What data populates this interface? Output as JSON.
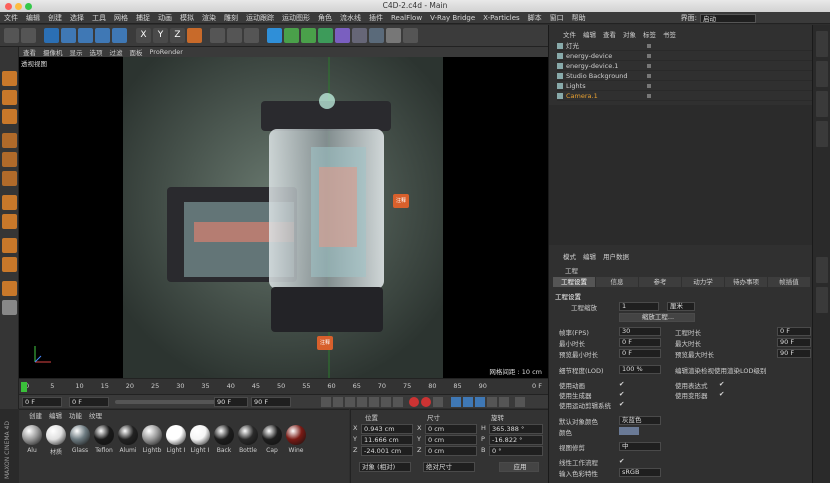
{
  "window": {
    "title": "C4D-2.c4d - Main"
  },
  "menu": [
    "文件",
    "编辑",
    "创建",
    "选择",
    "工具",
    "网格",
    "捕捉",
    "动画",
    "模拟",
    "渲染",
    "雕刻",
    "运动跟踪",
    "运动图形",
    "角色",
    "流水线",
    "插件",
    "RealFlow",
    "V-Ray Bridge",
    "X-Particles",
    "脚本",
    "窗口",
    "帮助"
  ],
  "layout": {
    "label": "界面:",
    "value": "启动"
  },
  "viewport": {
    "menu": [
      "查看",
      "摄像机",
      "显示",
      "选项",
      "过滤",
      "面板",
      "ProRender"
    ],
    "label": "透视视图",
    "grid_info": "网格间距 : 10 cm",
    "pins": [
      "注释",
      "注释"
    ]
  },
  "timeline": {
    "ticks": [
      "0",
      "5",
      "10",
      "15",
      "20",
      "25",
      "30",
      "35",
      "40",
      "45",
      "50",
      "55",
      "60",
      "65",
      "70",
      "75",
      "80",
      "85",
      "90"
    ],
    "frame_end": "0 F"
  },
  "playback": {
    "start": "0 F",
    "start2": "0 F",
    "end": "90 F",
    "end2": "90 F"
  },
  "materials": {
    "menu": [
      "创建",
      "编辑",
      "功能",
      "纹理"
    ],
    "items": [
      {
        "name": "Alu",
        "color": "#9a9a9a"
      },
      {
        "name": "材质",
        "color": "#e0e0e0"
      },
      {
        "name": "Glass",
        "color": "#6c7a80"
      },
      {
        "name": "Teflon",
        "color": "#1a1a1a"
      },
      {
        "name": "Alumi",
        "color": "#222222"
      },
      {
        "name": "Lightb",
        "color": "#9a9a9a"
      },
      {
        "name": "Light I",
        "color": "#ffffff"
      },
      {
        "name": "Light I",
        "color": "#f5f5f5"
      },
      {
        "name": "Back",
        "color": "#1d1d1d"
      },
      {
        "name": "Bottle",
        "color": "#2a2a2a"
      },
      {
        "name": "Cap",
        "color": "#1e1e1e"
      },
      {
        "name": "Wine",
        "color": "#7a1a14"
      }
    ]
  },
  "maxon": {
    "text": "MAXON CINEMA 4D"
  },
  "coords": {
    "headers": [
      "位置",
      "尺寸",
      "旋转"
    ],
    "rows": [
      {
        "axis": "X",
        "pos": "0.943 cm",
        "size": "0 cm",
        "rlabel": "H",
        "rot": "365.388 °"
      },
      {
        "axis": "Y",
        "pos": "11.666 cm",
        "size": "0 cm",
        "rlabel": "P",
        "rot": "-16.822 °"
      },
      {
        "axis": "Z",
        "pos": "-24.001 cm",
        "size": "0 cm",
        "rlabel": "B",
        "rot": "0 °"
      }
    ],
    "mode": "对象 (相对)",
    "size_mode": "绝对尺寸",
    "apply": "应用"
  },
  "objects": {
    "menu": [
      "文件",
      "编辑",
      "查看",
      "对象",
      "标签",
      "书签"
    ],
    "items": [
      {
        "name": "灯光",
        "color": "#cfcfcf"
      },
      {
        "name": "energy-device",
        "color": "#cfcfcf"
      },
      {
        "name": "energy-device.1",
        "color": "#cfcfcf"
      },
      {
        "name": "Studio Background",
        "color": "#cfcfcf"
      },
      {
        "name": "Lights",
        "color": "#cfcfcf"
      },
      {
        "name": "Camera.1",
        "color": "#e8a030"
      }
    ]
  },
  "attributes": {
    "menu": [
      "模式",
      "编辑",
      "用户数据"
    ],
    "section": "工程",
    "tabs": [
      "工程设置",
      "信息",
      "参考",
      "动力学",
      "待办事项",
      "帧插值"
    ],
    "group": "工程设置",
    "scale_label": "工程缩放",
    "scale_value": "1",
    "scale_unit": "厘米",
    "scale_button": "缩放工程...",
    "fps_label": "帧率(FPS)",
    "fps": "30",
    "duration_label": "工程时长",
    "duration": "0 F",
    "min_label": "最小时长",
    "min": "0 F",
    "max_label": "最大时长",
    "max": "90 F",
    "pmin_label": "预览最小时长",
    "pmin": "0 F",
    "pmax_label": "预览最大时长",
    "pmax": "90 F",
    "lod_label": "细节程度(LOD)",
    "lod": "100 %",
    "lod_note": "编辑渲染检视使用渲染LOD级别",
    "anim_label": "使用动画",
    "expr_label": "使用表达式",
    "gen_label": "使用生成器",
    "deform_label": "使用变形器",
    "motion_label": "使用运动剪辑系统",
    "defcolor_label": "默认对象颜色",
    "defcolor": "灰蓝色",
    "color_label": "颜色",
    "clip_label": "视图修剪",
    "clip": "中",
    "linear_label": "线性工作流程",
    "input_label": "输入色彩特性",
    "input": "sRGB"
  }
}
